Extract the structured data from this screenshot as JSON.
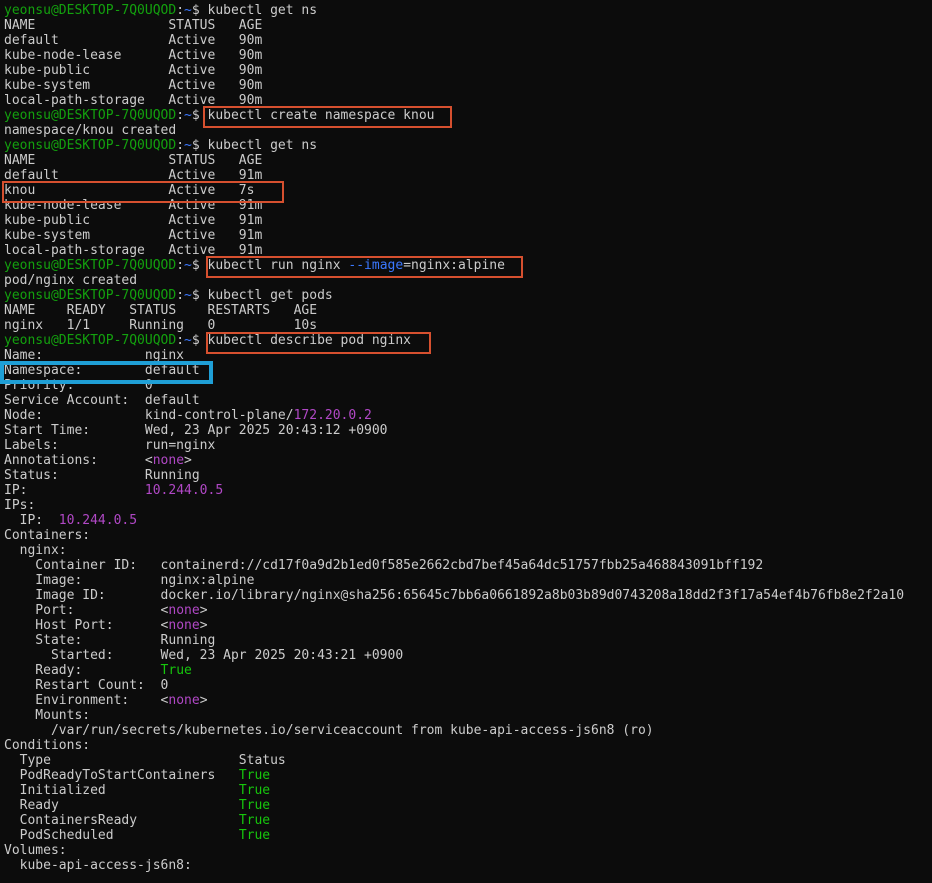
{
  "palette": {
    "default": "#cccccc",
    "prompt_user": "#13a10e",
    "prompt_path": "#3b78ff",
    "magenta": "#b148c6",
    "green": "#16c60c",
    "param": "#3b78ff"
  },
  "terminal": {
    "lines": [
      {
        "kind": "prompt",
        "segments": [
          {
            "t": "yeonsu@DESKTOP-7Q0UQOD",
            "c": "prompt_user"
          },
          {
            "t": ":",
            "c": "default"
          },
          {
            "t": "~",
            "c": "prompt_path"
          },
          {
            "t": "$ kubectl get ns",
            "c": "default"
          }
        ]
      },
      {
        "segments": [
          {
            "t": "NAME                 STATUS   AGE",
            "c": "default"
          }
        ]
      },
      {
        "segments": [
          {
            "t": "default              Active   90m",
            "c": "default"
          }
        ]
      },
      {
        "segments": [
          {
            "t": "kube-node-lease      Active   90m",
            "c": "default"
          }
        ]
      },
      {
        "segments": [
          {
            "t": "kube-public          Active   90m",
            "c": "default"
          }
        ]
      },
      {
        "segments": [
          {
            "t": "kube-system          Active   90m",
            "c": "default"
          }
        ]
      },
      {
        "segments": [
          {
            "t": "local-path-storage   Active   90m",
            "c": "default"
          }
        ]
      },
      {
        "kind": "prompt",
        "segments": [
          {
            "t": "yeonsu@DESKTOP-7Q0UQOD",
            "c": "prompt_user"
          },
          {
            "t": ":",
            "c": "default"
          },
          {
            "t": "~",
            "c": "prompt_path"
          },
          {
            "t": "$ kubectl create namespace knou",
            "c": "default"
          }
        ]
      },
      {
        "segments": [
          {
            "t": "namespace/knou created",
            "c": "default"
          }
        ]
      },
      {
        "kind": "prompt",
        "segments": [
          {
            "t": "yeonsu@DESKTOP-7Q0UQOD",
            "c": "prompt_user"
          },
          {
            "t": ":",
            "c": "default"
          },
          {
            "t": "~",
            "c": "prompt_path"
          },
          {
            "t": "$ kubectl get ns",
            "c": "default"
          }
        ]
      },
      {
        "segments": [
          {
            "t": "NAME                 STATUS   AGE",
            "c": "default"
          }
        ]
      },
      {
        "segments": [
          {
            "t": "default              Active   91m",
            "c": "default"
          }
        ]
      },
      {
        "segments": [
          {
            "t": "knou                 Active   7s",
            "c": "default"
          }
        ]
      },
      {
        "segments": [
          {
            "t": "kube-node-lease      Active   91m",
            "c": "default"
          }
        ]
      },
      {
        "segments": [
          {
            "t": "kube-public          Active   91m",
            "c": "default"
          }
        ]
      },
      {
        "segments": [
          {
            "t": "kube-system          Active   91m",
            "c": "default"
          }
        ]
      },
      {
        "segments": [
          {
            "t": "local-path-storage   Active   91m",
            "c": "default"
          }
        ]
      },
      {
        "kind": "prompt",
        "segments": [
          {
            "t": "yeonsu@DESKTOP-7Q0UQOD",
            "c": "prompt_user"
          },
          {
            "t": ":",
            "c": "default"
          },
          {
            "t": "~",
            "c": "prompt_path"
          },
          {
            "t": "$ kubectl run nginx ",
            "c": "default"
          },
          {
            "t": "--image",
            "c": "param"
          },
          {
            "t": "=nginx:alpine",
            "c": "default"
          }
        ]
      },
      {
        "segments": [
          {
            "t": "pod/nginx created",
            "c": "default"
          }
        ]
      },
      {
        "kind": "prompt",
        "segments": [
          {
            "t": "yeonsu@DESKTOP-7Q0UQOD",
            "c": "prompt_user"
          },
          {
            "t": ":",
            "c": "default"
          },
          {
            "t": "~",
            "c": "prompt_path"
          },
          {
            "t": "$ kubectl get pods",
            "c": "default"
          }
        ]
      },
      {
        "segments": [
          {
            "t": "NAME    READY   STATUS    RESTARTS   AGE",
            "c": "default"
          }
        ]
      },
      {
        "segments": [
          {
            "t": "nginx   1/1     Running   0          10s",
            "c": "default"
          }
        ]
      },
      {
        "kind": "prompt",
        "segments": [
          {
            "t": "yeonsu@DESKTOP-7Q0UQOD",
            "c": "prompt_user"
          },
          {
            "t": ":",
            "c": "default"
          },
          {
            "t": "~",
            "c": "prompt_path"
          },
          {
            "t": "$ kubectl describe pod nginx",
            "c": "default"
          }
        ]
      },
      {
        "segments": [
          {
            "t": "Name:             nginx",
            "c": "default"
          }
        ]
      },
      {
        "segments": [
          {
            "t": "Namespace:        default",
            "c": "default"
          }
        ]
      },
      {
        "segments": [
          {
            "t": "Priority:         0",
            "c": "default"
          }
        ]
      },
      {
        "segments": [
          {
            "t": "Service Account:  default",
            "c": "default"
          }
        ]
      },
      {
        "segments": [
          {
            "t": "Node:             kind-control-plane/",
            "c": "default"
          },
          {
            "t": "172.20.0.2",
            "c": "magenta"
          }
        ]
      },
      {
        "segments": [
          {
            "t": "Start Time:       Wed, 23 Apr 2025 20:43:12 +0900",
            "c": "default"
          }
        ]
      },
      {
        "segments": [
          {
            "t": "Labels:           run=nginx",
            "c": "default"
          }
        ]
      },
      {
        "segments": [
          {
            "t": "Annotations:      ",
            "c": "default"
          },
          {
            "t": "<",
            "c": "default"
          },
          {
            "t": "none",
            "c": "magenta"
          },
          {
            "t": ">",
            "c": "default"
          }
        ]
      },
      {
        "segments": [
          {
            "t": "Status:           Running",
            "c": "default"
          }
        ]
      },
      {
        "segments": [
          {
            "t": "IP:               ",
            "c": "default"
          },
          {
            "t": "10.244.0.5",
            "c": "magenta"
          }
        ]
      },
      {
        "segments": [
          {
            "t": "IPs:",
            "c": "default"
          }
        ]
      },
      {
        "segments": [
          {
            "t": "  IP:  ",
            "c": "default"
          },
          {
            "t": "10.244.0.5",
            "c": "magenta"
          }
        ]
      },
      {
        "segments": [
          {
            "t": "Containers:",
            "c": "default"
          }
        ]
      },
      {
        "segments": [
          {
            "t": "  nginx:",
            "c": "default"
          }
        ]
      },
      {
        "segments": [
          {
            "t": "    Container ID:   containerd://cd17f0a9d2b1ed0f585e2662cbd7bef45a64dc51757fbb25a468843091bff192",
            "c": "default"
          }
        ]
      },
      {
        "segments": [
          {
            "t": "    Image:          nginx:alpine",
            "c": "default"
          }
        ]
      },
      {
        "segments": [
          {
            "t": "    Image ID:       docker.io/library/nginx@sha256:65645c7bb6a0661892a8b03b89d0743208a18dd2f3f17a54ef4b76fb8e2f2a10",
            "c": "default"
          }
        ]
      },
      {
        "segments": [
          {
            "t": "    Port:           ",
            "c": "default"
          },
          {
            "t": "<",
            "c": "default"
          },
          {
            "t": "none",
            "c": "magenta"
          },
          {
            "t": ">",
            "c": "default"
          }
        ]
      },
      {
        "segments": [
          {
            "t": "    Host Port:      ",
            "c": "default"
          },
          {
            "t": "<",
            "c": "default"
          },
          {
            "t": "none",
            "c": "magenta"
          },
          {
            "t": ">",
            "c": "default"
          }
        ]
      },
      {
        "segments": [
          {
            "t": "    State:          Running",
            "c": "default"
          }
        ]
      },
      {
        "segments": [
          {
            "t": "      Started:      Wed, 23 Apr 2025 20:43:21 +0900",
            "c": "default"
          }
        ]
      },
      {
        "segments": [
          {
            "t": "    Ready:          ",
            "c": "default"
          },
          {
            "t": "True",
            "c": "green"
          }
        ]
      },
      {
        "segments": [
          {
            "t": "    Restart Count:  0",
            "c": "default"
          }
        ]
      },
      {
        "segments": [
          {
            "t": "    Environment:    ",
            "c": "default"
          },
          {
            "t": "<",
            "c": "default"
          },
          {
            "t": "none",
            "c": "magenta"
          },
          {
            "t": ">",
            "c": "default"
          }
        ]
      },
      {
        "segments": [
          {
            "t": "    Mounts:",
            "c": "default"
          }
        ]
      },
      {
        "segments": [
          {
            "t": "      /var/run/secrets/kubernetes.io/serviceaccount from kube-api-access-js6n8 (ro)",
            "c": "default"
          }
        ]
      },
      {
        "segments": [
          {
            "t": "Conditions:",
            "c": "default"
          }
        ]
      },
      {
        "segments": [
          {
            "t": "  Type                        Status",
            "c": "default"
          }
        ]
      },
      {
        "segments": [
          {
            "t": "  PodReadyToStartContainers   ",
            "c": "default"
          },
          {
            "t": "True",
            "c": "green"
          }
        ]
      },
      {
        "segments": [
          {
            "t": "  Initialized                 ",
            "c": "default"
          },
          {
            "t": "True",
            "c": "green"
          }
        ]
      },
      {
        "segments": [
          {
            "t": "  Ready                       ",
            "c": "default"
          },
          {
            "t": "True",
            "c": "green"
          }
        ]
      },
      {
        "segments": [
          {
            "t": "  ContainersReady             ",
            "c": "default"
          },
          {
            "t": "True",
            "c": "green"
          }
        ]
      },
      {
        "segments": [
          {
            "t": "  PodScheduled                ",
            "c": "default"
          },
          {
            "t": "True",
            "c": "green"
          }
        ]
      },
      {
        "segments": [
          {
            "t": "Volumes:",
            "c": "default"
          }
        ]
      },
      {
        "segments": [
          {
            "t": "  kube-api-access-js6n8:",
            "c": "default"
          }
        ]
      }
    ]
  }
}
